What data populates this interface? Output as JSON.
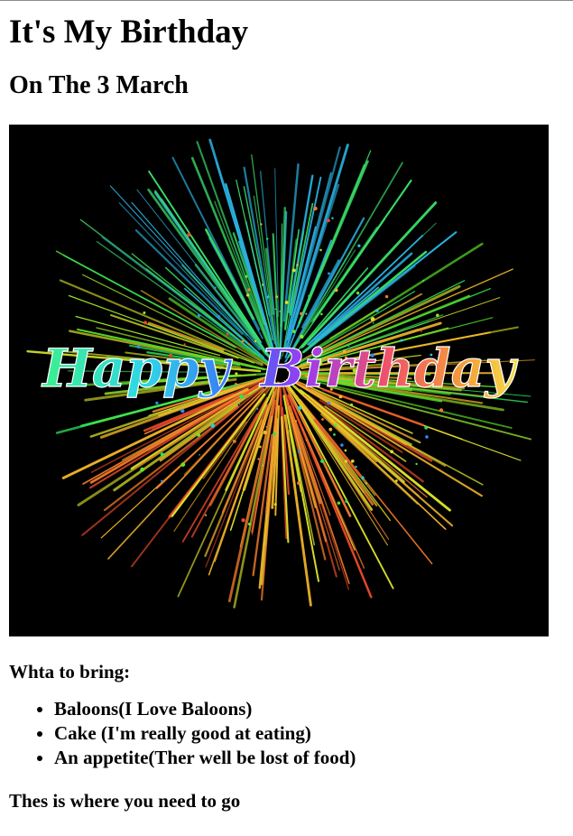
{
  "page": {
    "title": "It's My Birthday",
    "subtitle": "On The 3 March"
  },
  "image": {
    "caption_word_1": "Happy",
    "caption_word_2": "Birthday"
  },
  "bring": {
    "label": "Whta to bring:",
    "items": [
      "Baloons(I Love Baloons)",
      "Cake (I'm really good at eating)",
      "An appetite(Ther well be lost of food)"
    ]
  },
  "directions": {
    "label": "Thes is where you need to go"
  },
  "colors": {
    "background": "#ffffff",
    "text": "#000000",
    "image_background": "#000000"
  }
}
